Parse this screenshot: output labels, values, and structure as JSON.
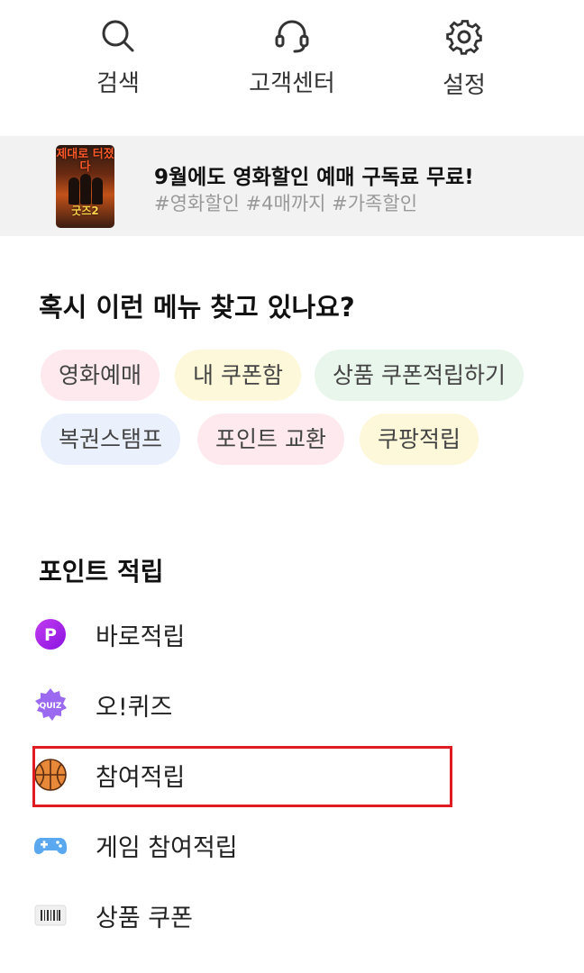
{
  "top_actions": {
    "search": "검색",
    "customer_center": "고객센터",
    "settings": "설정"
  },
  "banner": {
    "poster_title": "제대로 터졌다",
    "poster_subtitle": "굿즈2",
    "title": "9월에도 영화할인 예매 구독료 무료!",
    "tags": "#영화할인 #4매까지 #가족할인"
  },
  "suggest": {
    "title": "혹시 이런 메뉴 찾고 있나요?",
    "chips": [
      "영화예매",
      "내 쿠폰함",
      "상품 쿠폰적립하기",
      "복권스탬프",
      "포인트 교환",
      "쿠팡적립"
    ]
  },
  "points": {
    "title": "포인트 적립",
    "items": [
      "바로적립",
      "오!퀴즈",
      "참여적립",
      "게임 참여적립",
      "상품 쿠폰"
    ],
    "quiz_badge": "QUIZ",
    "p_badge": "P"
  },
  "colors": {
    "highlight": "#e11b22",
    "purple": "#a020e8"
  },
  "icons": [
    "search-icon",
    "headset-icon",
    "gear-icon",
    "p-coin-icon",
    "quiz-badge-icon",
    "basketball-icon",
    "gamepad-icon",
    "barcode-icon"
  ]
}
